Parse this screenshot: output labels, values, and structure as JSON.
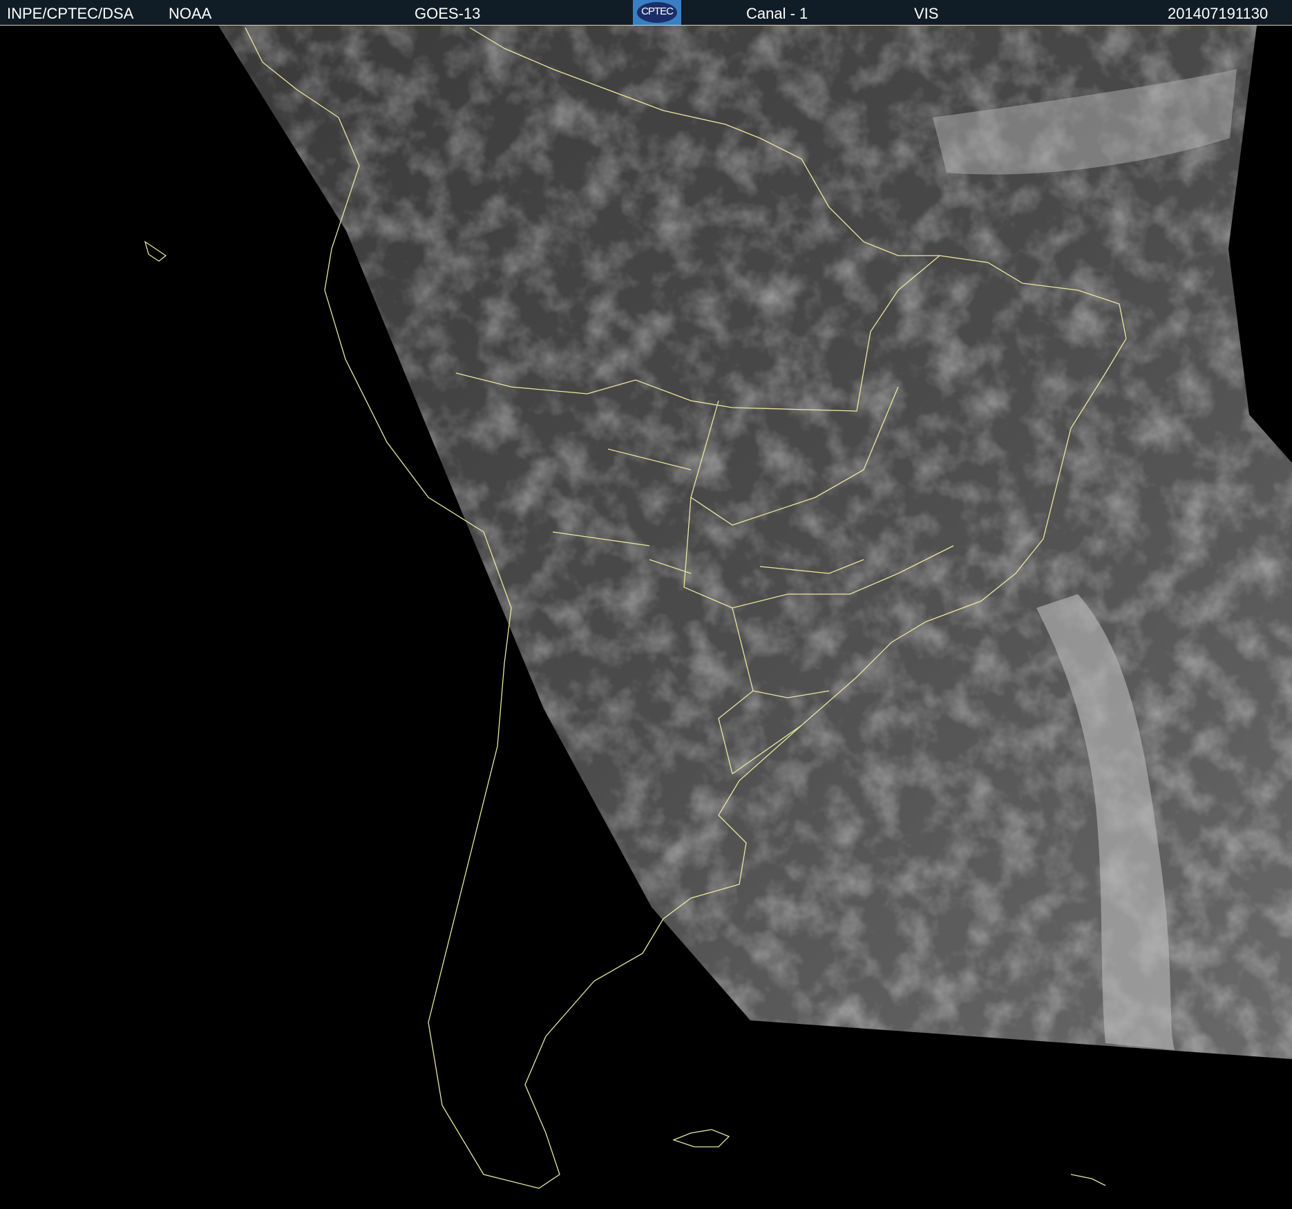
{
  "header": {
    "institution": "INPE/CPTEC/DSA",
    "agency": "NOAA",
    "satellite": "GOES-13",
    "logo_text": "CPTEC",
    "channel": "Canal - 1",
    "band": "VIS",
    "timestamp": "201407191130"
  },
  "colors": {
    "header_bg": "#111d26",
    "coastline": "#e8e8a0",
    "background": "#000000"
  }
}
